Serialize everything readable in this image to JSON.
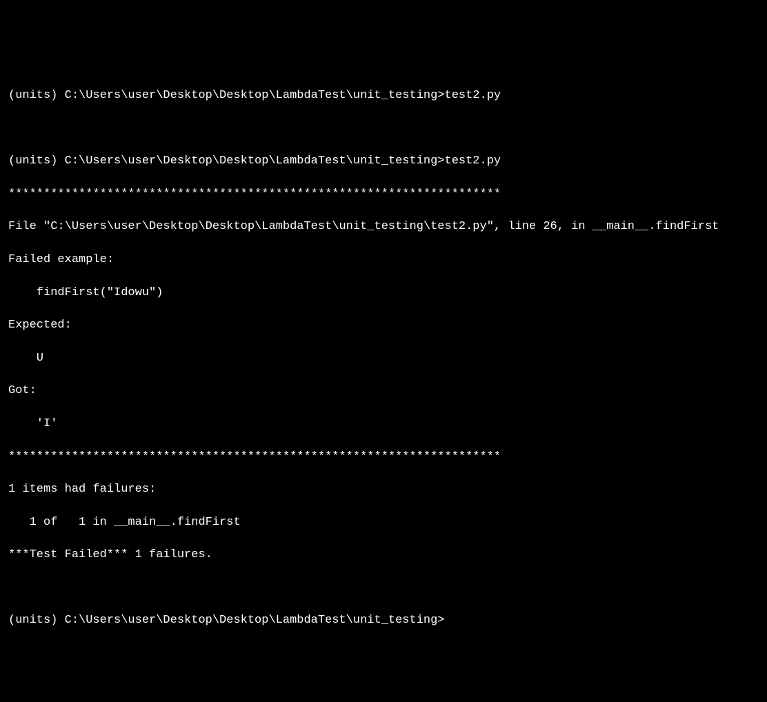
{
  "terminal": {
    "line1_prompt": "(units) C:\\Users\\user\\Desktop\\Desktop\\LambdaTest\\unit_testing>test2.py",
    "blank1": "",
    "line2_prompt": "(units) C:\\Users\\user\\Desktop\\Desktop\\LambdaTest\\unit_testing>test2.py",
    "line3_stars": "**********************************************************************",
    "line4_file": "File \"C:\\Users\\user\\Desktop\\Desktop\\LambdaTest\\unit_testing\\test2.py\", line 26, in __main__.findFirst",
    "line5_failed": "Failed example:",
    "line6_call": "    findFirst(\"Idowu\")",
    "line7_expected": "Expected:",
    "line8_u": "    U",
    "line9_got": "Got:",
    "line10_i": "    'I'",
    "line11_stars": "**********************************************************************",
    "line12_items": "1 items had failures:",
    "line13_of": "   1 of   1 in __main__.findFirst",
    "line14_testfailed": "***Test Failed*** 1 failures.",
    "blank2": "",
    "line15_prompt": "(units) C:\\Users\\user\\Desktop\\Desktop\\LambdaTest\\unit_testing>"
  }
}
